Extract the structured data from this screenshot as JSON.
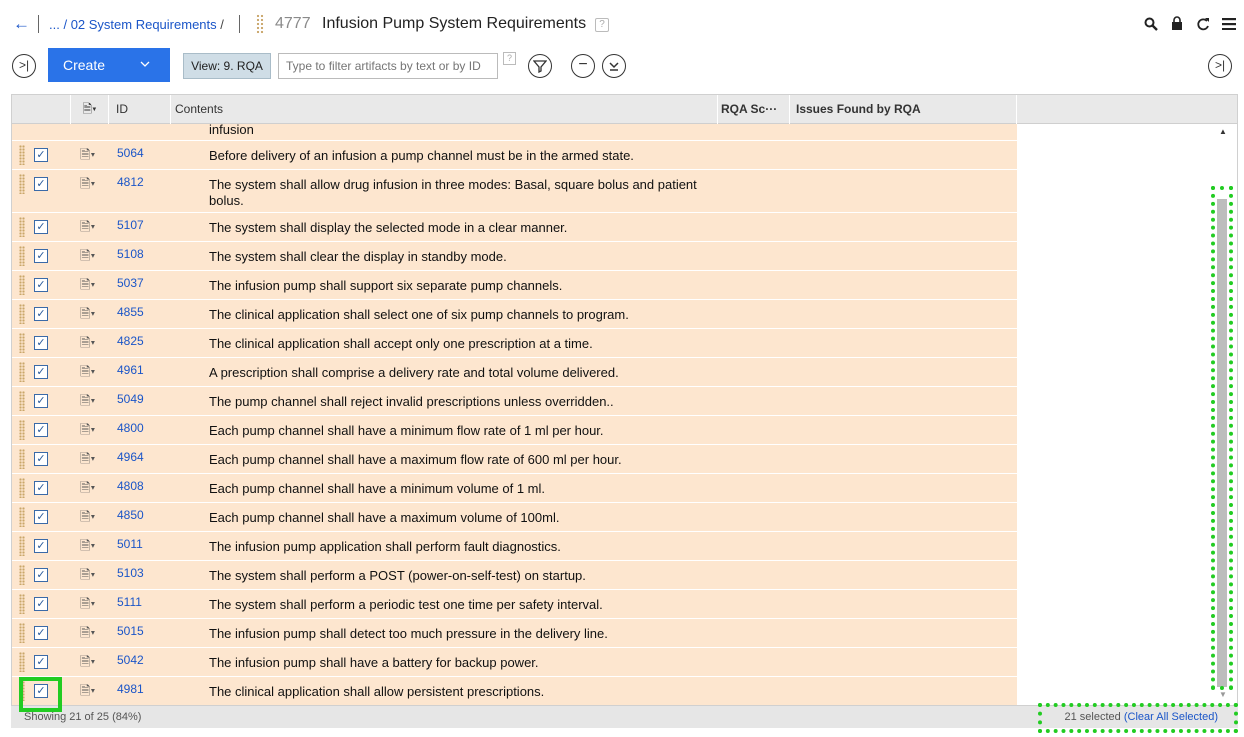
{
  "header": {
    "back_icon": "←",
    "breadcrumb_prefix": "... /",
    "breadcrumb_folder": "02 System Requirements",
    "breadcrumb_suffix": "/",
    "artifact_id": "4777",
    "artifact_title": "Infusion Pump System Requirements",
    "help_icon": "?",
    "icons": [
      "search-icon",
      "lock-icon",
      "refresh-icon",
      "menu-icon"
    ]
  },
  "toolbar": {
    "collapse_icon": ">|",
    "create_label": "Create",
    "create_caret": "v",
    "view_label": "View: 9. RQA",
    "filter_placeholder": "Type to filter artifacts by text or by ID",
    "filter_help": "?",
    "filter_icon": "filter",
    "collapse_all_icon": "−",
    "expand_all_icon": "≚",
    "right_collapse_icon": ">|"
  },
  "grid": {
    "columns": [
      "",
      "",
      "ID",
      "Contents",
      "RQA Sc···",
      "Issues Found by RQA"
    ],
    "partial_text": "infusion",
    "rows": [
      {
        "id": "5064",
        "text": "Before delivery of an infusion a pump channel must be in the armed state.",
        "checked": true
      },
      {
        "id": "4812",
        "text": "The system shall allow drug infusion in three modes: Basal, square bolus and patient bolus.",
        "checked": true
      },
      {
        "id": "5107",
        "text": "The system shall display the selected mode in a clear manner.",
        "checked": true
      },
      {
        "id": "5108",
        "text": "The system shall clear the display in standby mode.",
        "checked": true
      },
      {
        "id": "5037",
        "text": "The infusion pump shall support six separate pump channels.",
        "checked": true
      },
      {
        "id": "4855",
        "text": "The clinical application shall select one of six pump channels to program.",
        "checked": true
      },
      {
        "id": "4825",
        "text": "The clinical application shall accept only one prescription at a time.",
        "checked": true
      },
      {
        "id": "4961",
        "text": "A prescription shall comprise a delivery rate and total volume delivered.",
        "checked": true
      },
      {
        "id": "5049",
        "text": "The pump channel shall reject invalid prescriptions unless overridden..",
        "checked": true
      },
      {
        "id": "4800",
        "text": "Each pump channel shall have a minimum flow rate of 1 ml per hour.",
        "checked": true
      },
      {
        "id": "4964",
        "text": "Each pump channel shall have a maximum flow rate of 600 ml per hour.",
        "checked": true
      },
      {
        "id": "4808",
        "text": "Each pump channel shall have a minimum volume of 1 ml.",
        "checked": true
      },
      {
        "id": "4850",
        "text": "Each pump channel shall have a maximum volume of 100ml.",
        "checked": true
      },
      {
        "id": "5011",
        "text": "The infusion pump application shall perform fault diagnostics.",
        "checked": true
      },
      {
        "id": "5103",
        "text": "The system shall perform a POST (power-on-self-test) on startup.",
        "checked": true
      },
      {
        "id": "5111",
        "text": "The system shall perform a periodic test one time per safety interval.",
        "checked": true
      },
      {
        "id": "5015",
        "text": "The infusion pump shall detect too much pressure in the delivery line.",
        "checked": true
      },
      {
        "id": "5042",
        "text": "The infusion pump shall have a battery for backup power.",
        "checked": true
      },
      {
        "id": "4981",
        "text": "The clinical application shall allow persistent prescriptions.",
        "checked": true
      }
    ]
  },
  "footer": {
    "showing": "Showing 21 of 25 (84%)",
    "selected_count": "21 selected",
    "clear_open": "(",
    "clear_label": "Clear All Selected",
    "clear_close": ")"
  },
  "colors": {
    "accent": "#2a73e8",
    "row_bg": "#fde6cf",
    "highlight": "#22cc22"
  }
}
